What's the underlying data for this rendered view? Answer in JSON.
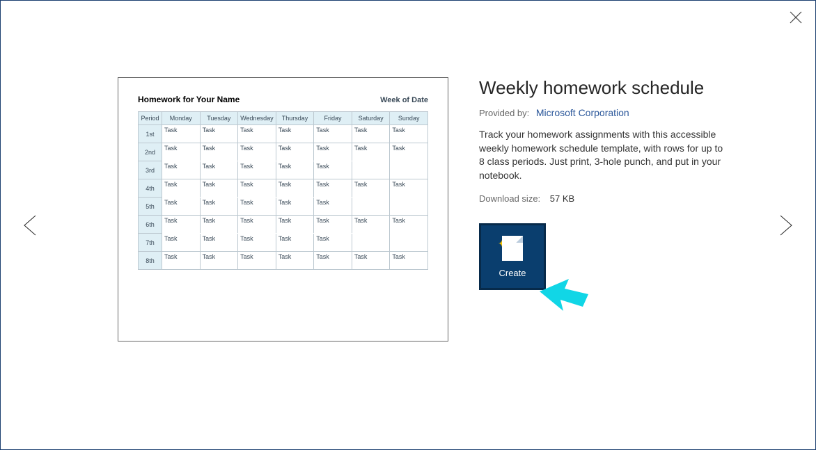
{
  "template": {
    "title": "Weekly homework schedule",
    "provided_by_label": "Provided by:",
    "provider": "Microsoft Corporation",
    "description": "Track your homework assignments with this accessible weekly homework schedule template, with rows for up to 8 class periods. Just print, 3-hole punch, and put in your notebook.",
    "download_label": "Download size:",
    "download_size": "57 KB",
    "create_label": "Create"
  },
  "preview": {
    "heading": "Homework for Your Name",
    "week_label": "Week of Date",
    "period_header": "Period",
    "days": [
      "Monday",
      "Tuesday",
      "Wednesday",
      "Thursday",
      "Friday",
      "Saturday",
      "Sunday"
    ],
    "periods": [
      "1st",
      "2nd",
      "3rd",
      "4th",
      "5th",
      "6th",
      "7th",
      "8th"
    ],
    "cell_placeholder": "Task"
  }
}
